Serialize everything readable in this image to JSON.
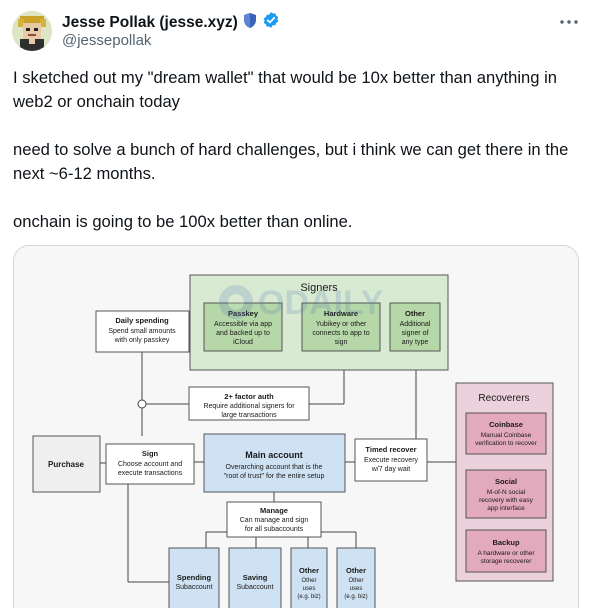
{
  "author": {
    "display_name": "Jesse Pollak (jesse.xyz)",
    "handle": "@jessepollak",
    "badge_color": "#1d9bf0",
    "shield_color": "#3a63b5"
  },
  "more_icon": "more-horizontal-icon",
  "tweet": {
    "paragraphs": [
      "I sketched out my \"dream wallet\" that would be 10x better than anything in web2 or onchain today",
      "need to solve a bunch of hard challenges, but i think we can get there in the next ~6-12 months.",
      "onchain is going to be 100x better than online."
    ]
  },
  "diagram": {
    "signers": {
      "title": "Signers",
      "passkey": {
        "title": "Passkey",
        "desc_1": "Accessible via app",
        "desc_2": "and backed up to",
        "desc_3": "iCloud"
      },
      "hardware": {
        "title": "Hardware",
        "desc_1": "Yubikey or other",
        "desc_2": "connects to app to",
        "desc_3": "sign"
      },
      "other": {
        "title": "Other",
        "desc_1": "Additional",
        "desc_2": "signer of",
        "desc_3": "any type"
      }
    },
    "daily_spending": {
      "title": "Daily spending",
      "desc_1": "Spend small amounts",
      "desc_2": "with only passkey"
    },
    "factor_auth": {
      "title": "2+ factor auth",
      "desc_1": "Require additional signers for",
      "desc_2": "large transactions"
    },
    "purchase": {
      "title": "Purchase"
    },
    "sign": {
      "title": "Sign",
      "desc_1": "Choose account and",
      "desc_2": "execute transactions"
    },
    "main_account": {
      "title": "Main account",
      "desc_1": "Overarching account that is the",
      "desc_2": "\"root of trust\" for the entire setup"
    },
    "timed_recover": {
      "title": "Timed recover",
      "desc_1": "Execute recovery",
      "desc_2": "w/7 day wait"
    },
    "manage": {
      "title": "Manage",
      "desc_1": "Can manage and sign",
      "desc_2": "for all subaccounts"
    },
    "subaccounts": [
      {
        "title": "Spending",
        "desc_1": "Subaccount",
        "desc_2": ""
      },
      {
        "title": "Saving",
        "desc_1": "Subaccount",
        "desc_2": ""
      },
      {
        "title": "Other",
        "desc_1": "Other",
        "desc_2": "uses",
        "desc_3": "(e.g. biz)"
      },
      {
        "title": "Other",
        "desc_1": "Other",
        "desc_2": "uses",
        "desc_3": "(e.g. biz)"
      }
    ],
    "recoverers": {
      "title": "Recoverers",
      "coinbase": {
        "title": "Coinbase",
        "desc_1": "Manual Coinbase",
        "desc_2": "verification to recover"
      },
      "social": {
        "title": "Social",
        "desc_1": "M-of-N social",
        "desc_2": "recovery with easy",
        "desc_3": "app interface"
      },
      "backup": {
        "title": "Backup",
        "desc_1": "A hardware or other",
        "desc_2": "storage recoverer"
      }
    },
    "watermark": "ODAILY",
    "colors": {
      "green_fill": "#d9ead3",
      "green_inner": "#b6d7a8",
      "blue_fill": "#cfe2f3",
      "pink_fill": "#ead1dc",
      "pink_inner": "#e3a9bd",
      "gray_fill": "#efefef"
    }
  }
}
